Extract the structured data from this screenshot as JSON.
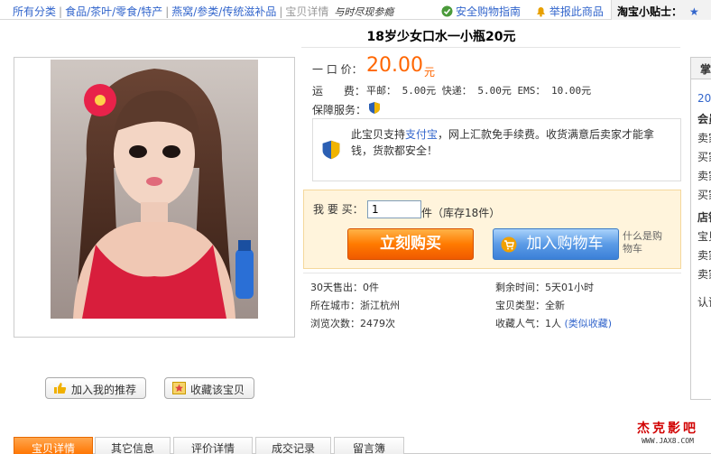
{
  "breadcrumb": {
    "items": [
      "所有分类",
      "食品/茶叶/零食/特产",
      "燕窝/参类/传统滋补品"
    ],
    "current": "宝贝详情",
    "tagline": "与时尽现参瘾"
  },
  "header_links": {
    "safe_guide": "安全购物指南",
    "report": "举报此商品",
    "tip_title": "淘宝小贴士："
  },
  "product": {
    "title": "18岁少女口水一小瓶20元",
    "price_label": "一 口 价：",
    "price": "20.00",
    "currency": "元",
    "shipping_label": "运      费：",
    "shipping": "平邮： 5.00元 快递： 5.00元 EMS： 10.00元",
    "guarantee_label": "保障服务：",
    "guarantee_text_pre": "此宝贝支持",
    "guarantee_link": "支付宝",
    "guarantee_text_post": "，网上汇款免手续费。收货满意后卖家才能拿钱，货款都安全！"
  },
  "purchase": {
    "qty_label": "我 要 买：",
    "qty_value": "1",
    "unit": "件",
    "stock": "（库存18件）",
    "buy_now": "立刻购买",
    "add_cart": "加入购物车",
    "what_is_cart": "什么是购物车"
  },
  "stats": {
    "sold_30d_label": "30天售出：",
    "sold_30d": "0件",
    "time_left_label": "剩余时间：",
    "time_left": "5天01小时",
    "city_label": "所在城市：",
    "city": "浙江杭州",
    "type_label": "宝贝类型：",
    "type": "全新",
    "views_label": "浏览次数：",
    "views": "2479次",
    "fav_label": "收藏人气：",
    "fav": "1人",
    "similar": "(类似收藏)"
  },
  "actions": {
    "recommend": "加入我的推荐",
    "favorite": "收藏该宝贝"
  },
  "sidebar": {
    "head": "掌",
    "lines": [
      "201",
      "会员",
      "卖家",
      "买家",
      "卖家",
      "买家",
      "店铺",
      "宝贝",
      "卖家",
      "卖家",
      "认证"
    ]
  },
  "tabs": [
    "宝贝详情",
    "其它信息",
    "评价详情",
    "成交记录",
    "留言簿"
  ],
  "watermark": {
    "name": "杰克影吧",
    "url": "WWW.JAX8.COM"
  },
  "colors": {
    "price": "#ff6600",
    "link": "#3366cc",
    "active_tab": "#ff7400"
  }
}
